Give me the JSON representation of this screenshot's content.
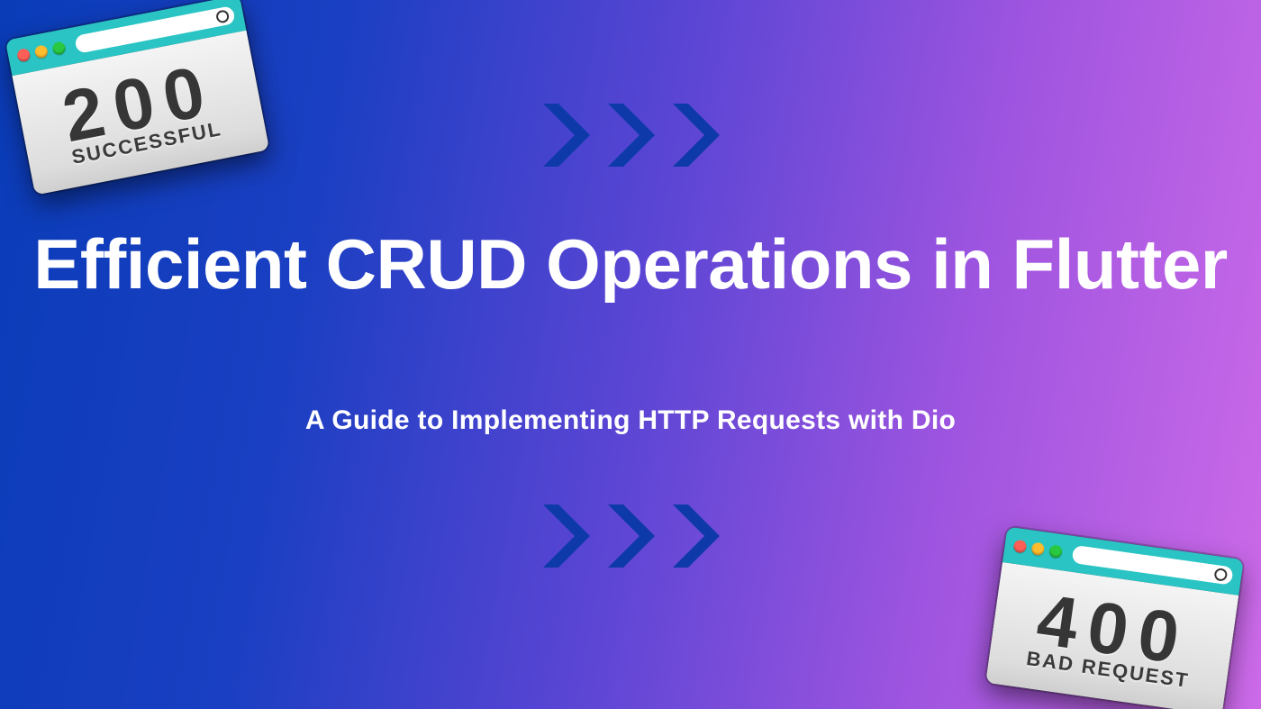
{
  "title": "Efficient CRUD Operations in Flutter",
  "subtitle": "A Guide to Implementing HTTP Requests with Dio",
  "cards": {
    "success": {
      "code": "200",
      "label": "SUCCESSFUL"
    },
    "error": {
      "code": "400",
      "label": "BAD REQUEST"
    }
  },
  "colors": {
    "chevron": "#0d3aa8",
    "gradient_start": "#0a3cb8",
    "gradient_end": "#cc6ae8"
  }
}
